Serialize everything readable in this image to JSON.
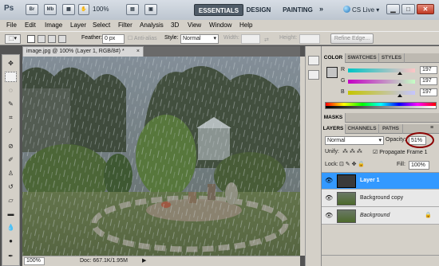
{
  "app": {
    "logo": "Ps",
    "bar_icons": [
      "Br",
      "Mb",
      "grid",
      "hand",
      "zoom"
    ],
    "zoom": "100%",
    "workspaces": [
      "ESSENTIALS",
      "DESIGN",
      "PAINTING"
    ],
    "more": "»",
    "cs_live": "CS Live",
    "window_buttons": [
      "▁",
      "□",
      "✕"
    ]
  },
  "menu": [
    "File",
    "Edit",
    "Image",
    "Layer",
    "Select",
    "Filter",
    "Analysis",
    "3D",
    "View",
    "Window",
    "Help"
  ],
  "options": {
    "feather_label": "Feather:",
    "feather_value": "0 px",
    "anti_alias": "Anti-alias",
    "style_label": "Style:",
    "style_value": "Normal",
    "width_label": "Width:",
    "height_label": "Height:",
    "refine_edge": "Refine Edge..."
  },
  "document": {
    "tab_title": "image.jpg @ 100% (Layer 1, RGB/8#) *",
    "close": "×"
  },
  "status": {
    "zoom": "100%",
    "doc": "Doc: 667.1K/1.95M",
    "arrow": "▶"
  },
  "color_panel": {
    "tabs": [
      "COLOR",
      "SWATCHES",
      "STYLES"
    ],
    "channels": [
      {
        "label": "R",
        "value": "197",
        "fraction": 0.77
      },
      {
        "label": "G",
        "value": "197",
        "fraction": 0.77
      },
      {
        "label": "B",
        "value": "197",
        "fraction": 0.77
      }
    ]
  },
  "masks_panel": {
    "tabs": [
      "MASKS"
    ]
  },
  "layers_panel": {
    "tabs": [
      "LAYERS",
      "CHANNELS",
      "PATHS"
    ],
    "blend_mode": "Normal",
    "opacity_label": "Opacity:",
    "opacity_value": "51%",
    "unify_label": "Unify:",
    "propagate_label": "Propagate Frame 1",
    "lock_label": "Lock:",
    "fill_label": "Fill:",
    "fill_value": "100%",
    "layers": [
      {
        "name": "Layer 1",
        "selected": true
      },
      {
        "name": "Background copy",
        "selected": false
      },
      {
        "name": "Background",
        "selected": false,
        "italic": true
      }
    ]
  },
  "colors": {
    "highlight": "#3399ff",
    "annotation_circle": "#8b0000"
  }
}
